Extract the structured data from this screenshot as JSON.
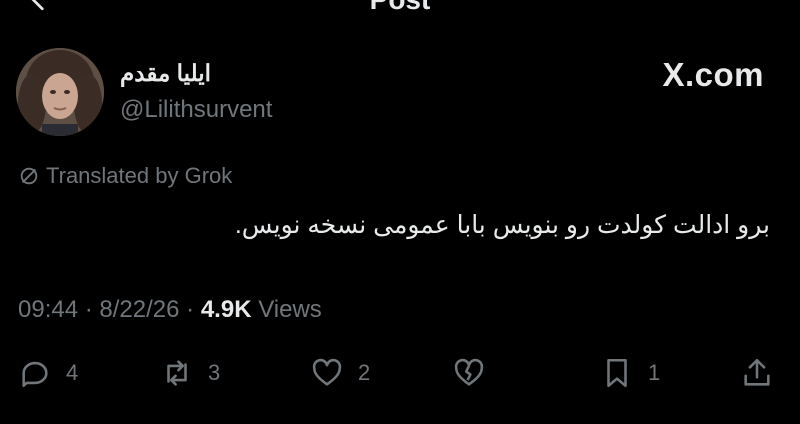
{
  "header": {
    "title": "Post"
  },
  "author": {
    "display_name": "ایلیا مقدم",
    "handle": "@Lilithsurvent"
  },
  "watermark": "X.com",
  "translation_label": "Translated by Grok",
  "post": {
    "text": "برو ادالت کولدت رو بنویس بابا عمومی نسخه نویس."
  },
  "meta": {
    "time": "09:44",
    "date": "8/22/26",
    "views_count": "4.9K",
    "views_label": "Views",
    "separator": "·"
  },
  "actions": {
    "reply_count": "4",
    "repost_count": "3",
    "like_count": "2",
    "bookmark_count": "1"
  },
  "colors": {
    "background": "#000000",
    "text": "#e7e9ea",
    "muted": "#71767b"
  }
}
